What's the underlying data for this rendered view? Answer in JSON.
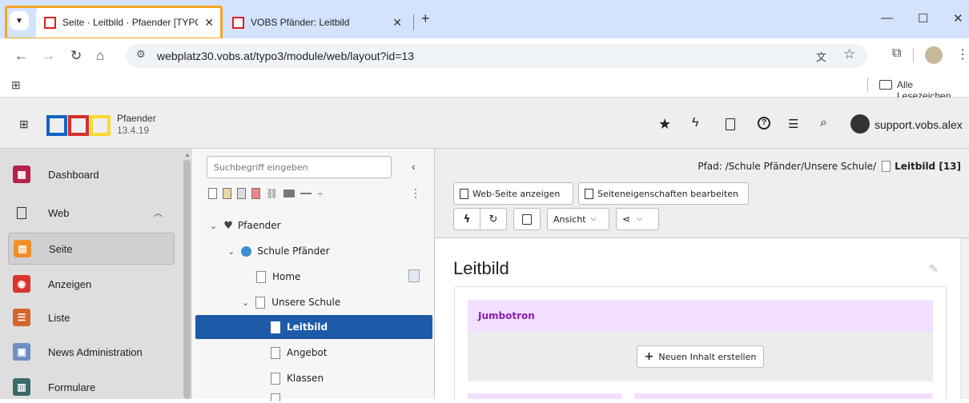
{
  "browser": {
    "tabs": [
      {
        "title": "Seite · Leitbild · Pfaender [TYPO",
        "close": "✕"
      },
      {
        "title": "VOBS Pfänder: Leitbild",
        "close": "✕"
      }
    ],
    "new_tab": "+",
    "url": "webplatz30.vobs.at/typo3/module/web/layout?id=13",
    "bookmarks_label": "Alle Lesezeichen"
  },
  "typo3": {
    "site_name": "Pfaender",
    "version": "13.4.19",
    "user": "support.vobs.alex",
    "brand_colors": [
      "#1565c0",
      "#d32f2f",
      "#fdd835"
    ]
  },
  "modules": [
    {
      "label": "Dashboard",
      "icon": "dashboard-icon",
      "color": "#b5214b"
    },
    {
      "label": "Web",
      "icon": "web-page-icon",
      "group": true
    },
    {
      "label": "Seite",
      "icon": "page-module-icon",
      "color": "#f18f2a",
      "active": true
    },
    {
      "label": "Anzeigen",
      "icon": "eye-icon",
      "color": "#d9352e"
    },
    {
      "label": "Liste",
      "icon": "list-icon",
      "color": "#d7642c"
    },
    {
      "label": "News Administration",
      "icon": "news-icon",
      "color": "#6f8fc3"
    },
    {
      "label": "Formulare",
      "icon": "form-icon",
      "color": "#3a6b68"
    }
  ],
  "tree": {
    "search_placeholder": "Suchbegriff eingeben",
    "nodes": [
      {
        "label": "Pfaender"
      },
      {
        "label": "Schule Pfänder"
      },
      {
        "label": "Home"
      },
      {
        "label": "Unsere Schule"
      },
      {
        "label": "Leitbild",
        "selected": true
      },
      {
        "label": "Angebot"
      },
      {
        "label": "Klassen"
      }
    ]
  },
  "doc": {
    "path_label": "Pfad: /Schule Pfänder/Unsere Schule/",
    "current_page": "Leitbild [13]",
    "btn_view": "Web-Seite anzeigen",
    "btn_props": "Seiteneigenschaften bearbeiten",
    "view_dropdown": "Ansicht",
    "page_title": "Leitbild",
    "column_title": "Jumbotron",
    "new_content": "Neuen Inhalt erstellen"
  }
}
